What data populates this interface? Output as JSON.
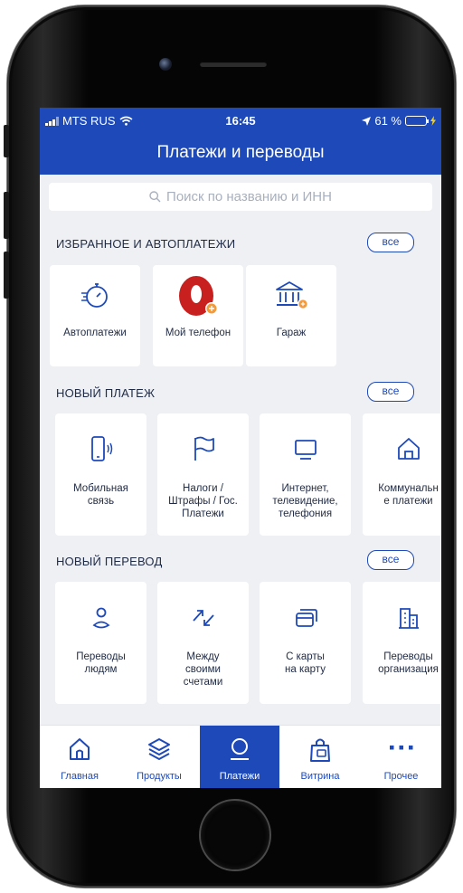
{
  "status_bar": {
    "carrier": "MTS RUS",
    "time": "16:45",
    "battery": "61 %",
    "battery_level": 0.61
  },
  "header": {
    "title": "Платежи и переводы"
  },
  "search": {
    "placeholder": "Поиск по названию и ИНН"
  },
  "favorites": {
    "title": "ИЗБРАННОЕ И АВТОПЛАТЕЖИ",
    "all_label": "все",
    "items": [
      {
        "label": "Автоплатежи",
        "icon": "autopay-timer-icon"
      },
      {
        "label": "Мой телефон",
        "icon": "mts-egg-logo-icon"
      },
      {
        "label": "Гараж",
        "icon": "bank-building-icon"
      }
    ]
  },
  "new_payment": {
    "title": "НОВЫЙ ПЛАТЕЖ",
    "all_label": "все",
    "items": [
      {
        "label": "Мобильная\nсвязь",
        "icon": "mobile-phone-icon"
      },
      {
        "label": "Налоги /\nШтрафы / Гос.\nПлатежи",
        "icon": "flag-icon"
      },
      {
        "label": "Интернет,\nтелевидение,\nтелефония",
        "icon": "monitor-icon"
      },
      {
        "label": "Коммунальн\nе платежи",
        "icon": "house-icon"
      }
    ]
  },
  "new_transfer": {
    "title": "НОВЫЙ ПЕРЕВОД",
    "all_label": "все",
    "items": [
      {
        "label": "Переводы\nлюдям",
        "icon": "person-icon"
      },
      {
        "label": "Между\nсвоими\nсчетами",
        "icon": "swap-arrows-icon"
      },
      {
        "label": "С карты\nна карту",
        "icon": "cards-icon"
      },
      {
        "label": "Переводы\nорганизация",
        "icon": "office-building-icon"
      }
    ]
  },
  "tabbar": {
    "items": [
      {
        "label": "Главная",
        "icon": "home-icon"
      },
      {
        "label": "Продукты",
        "icon": "layers-icon"
      },
      {
        "label": "Платежи",
        "icon": "payments-icon",
        "active": true
      },
      {
        "label": "Витрина",
        "icon": "shopping-bag-icon"
      },
      {
        "label": "Прочее",
        "icon": "more-dots-icon"
      }
    ]
  },
  "colors": {
    "brand": "#1d49b9",
    "background": "#eef0f4",
    "accent_orange": "#f39a3a",
    "mts_red": "#c8201f"
  }
}
